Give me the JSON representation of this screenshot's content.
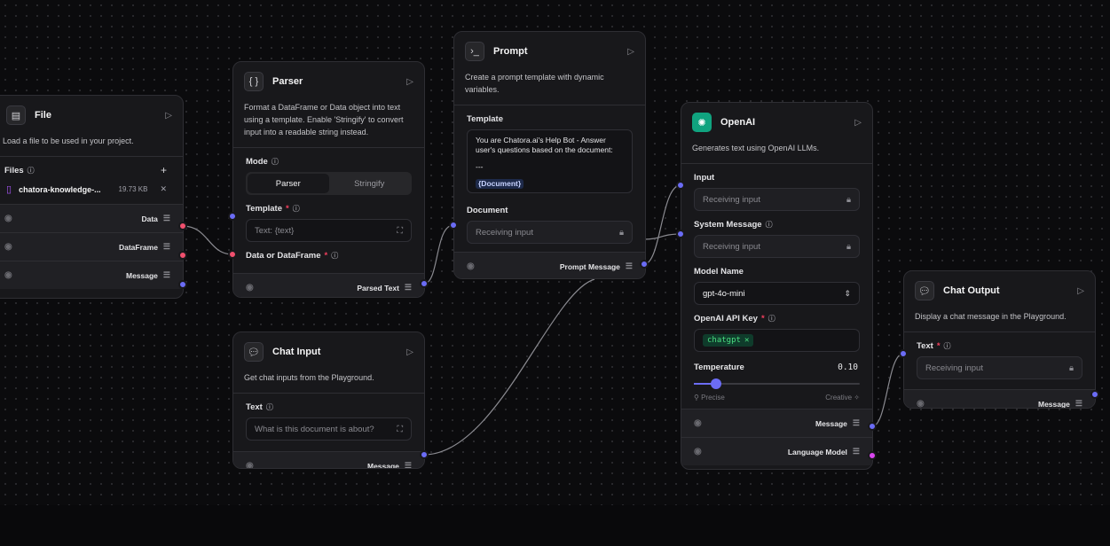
{
  "file_node": {
    "title": "File",
    "description": "Load a file to be used in your project.",
    "files_label": "Files",
    "file_name": "chatora-knowledge-...",
    "file_size": "19.73 KB",
    "outputs": [
      "Data",
      "DataFrame",
      "Message"
    ]
  },
  "parser_node": {
    "title": "Parser",
    "description": "Format a DataFrame or Data object into text using a template. Enable 'Stringify' to convert input into a readable string instead.",
    "mode_label": "Mode",
    "mode_options": [
      "Parser",
      "Stringify"
    ],
    "template_label": "Template",
    "template_placeholder": "Text: {text}",
    "data_label": "Data or DataFrame",
    "output": "Parsed Text"
  },
  "prompt_node": {
    "title": "Prompt",
    "description": "Create a prompt template with dynamic variables.",
    "template_label": "Template",
    "template_line1": "You are Chatora.ai's Help Bot - Answer user's questions based on the document:",
    "template_line2": "---",
    "template_var": "{Document}",
    "document_label": "Document",
    "document_value": "Receiving input",
    "output": "Prompt Message"
  },
  "chat_input_node": {
    "title": "Chat Input",
    "description": "Get chat inputs from the Playground.",
    "text_label": "Text",
    "text_placeholder": "What is this document is about?",
    "output": "Message"
  },
  "openai_node": {
    "title": "OpenAI",
    "description": "Generates text using OpenAI LLMs.",
    "input_label": "Input",
    "input_value": "Receiving input",
    "system_label": "System Message",
    "system_value": "Receiving input",
    "model_label": "Model Name",
    "model_value": "gpt-4o-mini",
    "key_label": "OpenAI API Key",
    "key_value": "chatgpt",
    "temp_label": "Temperature",
    "temp_value": "0.10",
    "temp_fraction": 0.1,
    "precise_label": "Precise",
    "creative_label": "Creative",
    "outputs": [
      "Message",
      "Language Model"
    ]
  },
  "chat_output_node": {
    "title": "Chat Output",
    "description": "Display a chat message in the Playground.",
    "text_label": "Text",
    "text_value": "Receiving input",
    "output": "Message"
  },
  "colors": {
    "handle_blue": "#6b6cf5",
    "handle_red": "#f0506e",
    "handle_pink": "#d946ef",
    "chip_green": "#4ade80"
  }
}
